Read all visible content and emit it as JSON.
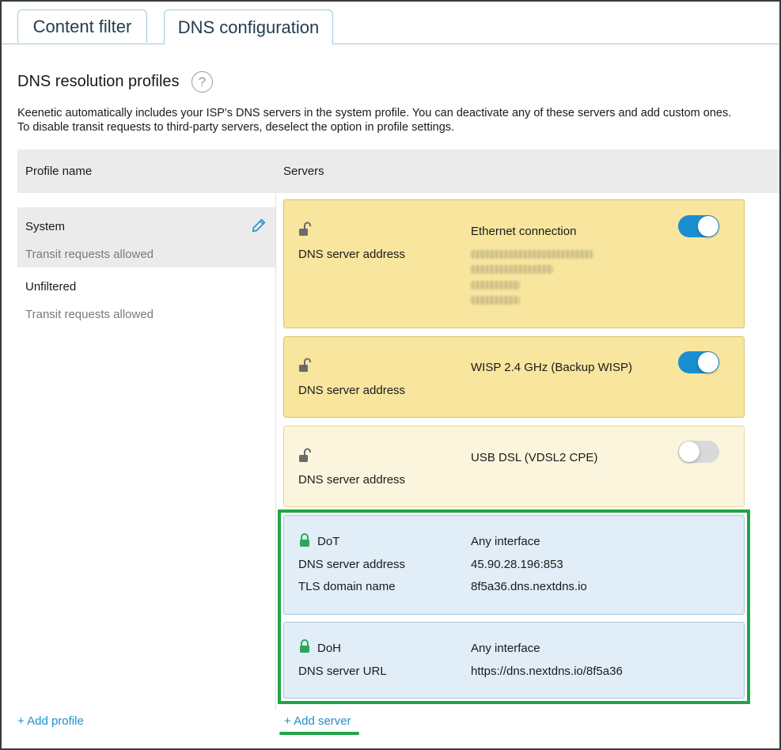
{
  "tabs": [
    {
      "label": "Content filter",
      "active": false
    },
    {
      "label": "DNS configuration",
      "active": true
    }
  ],
  "section": {
    "title": "DNS resolution profiles",
    "help_icon": "question-icon",
    "description_line1": "Keenetic automatically includes your ISP's DNS servers in the system profile. You can deactivate any of these servers and add custom ones.",
    "description_line2": "To disable transit requests to third-party servers, deselect the option in profile settings."
  },
  "table": {
    "col_profile": "Profile name",
    "col_servers": "Servers"
  },
  "profiles": [
    {
      "name": "System",
      "sub": "Transit requests allowed",
      "selected": true,
      "icon": "pencil-icon"
    },
    {
      "name": "Unfiltered",
      "sub": "Transit requests allowed",
      "selected": false
    }
  ],
  "servers": [
    {
      "interface": "Ethernet connection",
      "label": "DNS server address",
      "enabled": true,
      "address_obscured": true,
      "lock": "unlocked-icon"
    },
    {
      "interface": "WISP 2.4 GHz (Backup WISP)",
      "label": "DNS server address",
      "enabled": true,
      "lock": "unlocked-icon"
    },
    {
      "interface": "USB DSL (VDSL2 CPE)",
      "label": "DNS server address",
      "enabled": false,
      "lock": "unlocked-icon"
    },
    {
      "protocol": "DoT",
      "interface": "Any interface",
      "label": "DNS server address",
      "value": "45.90.28.196:853",
      "label2": "TLS domain name",
      "value2": "8f5a36.dns.nextdns.io",
      "lock": "locked-icon"
    },
    {
      "protocol": "DoH",
      "interface": "Any interface",
      "label": "DNS server URL",
      "value": "https://dns.nextdns.io/8f5a36",
      "lock": "locked-icon"
    }
  ],
  "actions": {
    "add_profile": "+ Add profile",
    "add_server": "+ Add server"
  },
  "colors": {
    "accent": "#1a8fd0",
    "highlight": "#21a546",
    "card_enabled": "#f8e59e",
    "card_disabled": "#fcf5dd",
    "card_secure": "#e1eef8"
  }
}
